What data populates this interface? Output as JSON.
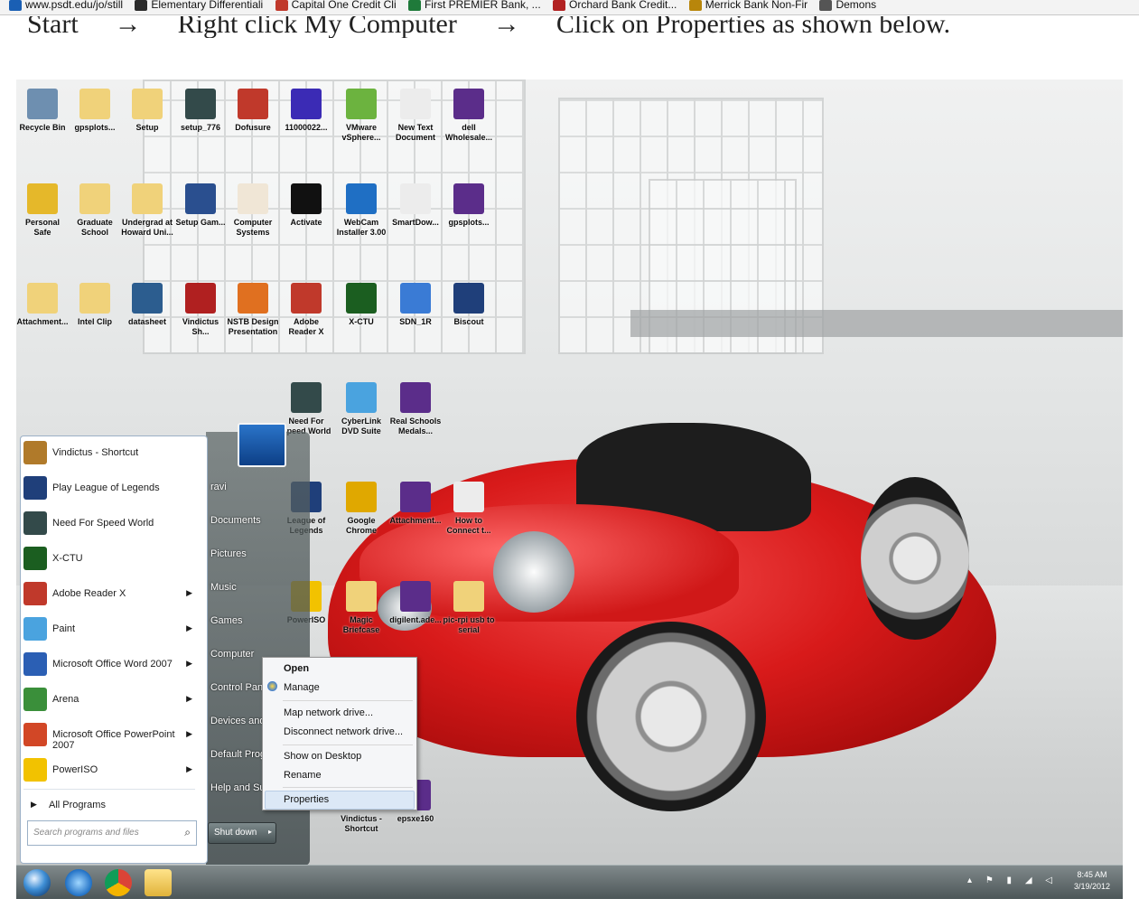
{
  "bookmarks": [
    {
      "label": "www.psdt.edu/jo/still",
      "color": "#1a5fb4"
    },
    {
      "label": "Elementary Differentiali",
      "color": "#2a2a2a"
    },
    {
      "label": "Capital One Credit Cli",
      "color": "#c0392b"
    },
    {
      "label": "First PREMIER Bank, ...",
      "color": "#1f7a3a"
    },
    {
      "label": "Orchard Bank Credit...",
      "color": "#b22222"
    },
    {
      "label": "Merrick Bank Non-Fir",
      "color": "#b8860b"
    },
    {
      "label": "Demons",
      "color": "#555555"
    }
  ],
  "caption": {
    "start": "Start",
    "step2": "Right click My Computer",
    "step3": "Click on Properties as shown below.",
    "arrow": "→"
  },
  "desktop_icons": [
    {
      "label": "Recycle Bin",
      "color": "#6e8fb0"
    },
    {
      "label": "gpsplots...",
      "color": "#f0d27a"
    },
    {
      "label": "Setup",
      "color": "#f0d27a"
    },
    {
      "label": "setup_776",
      "color": "#334a4a"
    },
    {
      "label": "Dofusure",
      "color": "#c0392b"
    },
    {
      "label": "11000022...",
      "color": "#3b2bb5"
    },
    {
      "label": "VMware vSphere...",
      "color": "#6cb33f"
    },
    {
      "label": "New Text Document",
      "color": "#ececec"
    },
    {
      "label": "dell Wholesale...",
      "color": "#5b2d8a"
    },
    {
      "label": "Personal Safe",
      "color": "#e5b82a"
    },
    {
      "label": "Graduate School",
      "color": "#f0d27a"
    },
    {
      "label": "Undergrad at Howard Uni...",
      "color": "#f0d27a"
    },
    {
      "label": "Setup Gam...",
      "color": "#2a4f8f"
    },
    {
      "label": "Computer Systems",
      "color": "#f0e6d6"
    },
    {
      "label": "Activate",
      "color": "#111111"
    },
    {
      "label": "WebCam Installer 3.00",
      "color": "#1f6fc4"
    },
    {
      "label": "SmartDow...",
      "color": "#ececec"
    },
    {
      "label": "gpsplots...",
      "color": "#5b2d8a"
    },
    {
      "label": "Attachment...",
      "color": "#f0d27a"
    },
    {
      "label": "Intel Clip",
      "color": "#f0d27a"
    },
    {
      "label": "datasheet",
      "color": "#2c5d8f"
    },
    {
      "label": "Vindictus Sh...",
      "color": "#b02020"
    },
    {
      "label": "NSTB Design Presentation",
      "color": "#e07020"
    },
    {
      "label": "Adobe Reader X",
      "color": "#c0392b"
    },
    {
      "label": "X-CTU",
      "color": "#1b5e20"
    },
    {
      "label": "SDN_1R",
      "color": "#3a7bd5"
    },
    {
      "label": "Biscout",
      "color": "#1f3f7a"
    },
    {
      "label": "Need For Speed World",
      "color": "#334a4a"
    },
    {
      "label": "CyberLink DVD Suite",
      "color": "#4aa3df"
    },
    {
      "label": "Real Schools Medals...",
      "color": "#5b2d8a"
    },
    {
      "label": "League of Legends",
      "color": "#1f3f7a"
    },
    {
      "label": "Google Chrome",
      "color": "#e0a800"
    },
    {
      "label": "Attachment...",
      "color": "#5b2d8a"
    },
    {
      "label": "How to Connect t...",
      "color": "#ececec"
    },
    {
      "label": "PowerISO",
      "color": "#f2c200"
    },
    {
      "label": "Magic Briefcase",
      "color": "#f0d27a"
    },
    {
      "label": "digilent.ade...",
      "color": "#5b2d8a"
    },
    {
      "label": "pic-rpi usb to serial",
      "color": "#f0d27a"
    },
    {
      "label": "Vindictus - Shortcut",
      "color": "#888888"
    },
    {
      "label": "epsxe160",
      "color": "#5b2d8a"
    }
  ],
  "start_menu": {
    "pinned": [
      {
        "label": "Vindictus - Shortcut",
        "color": "#b07a2a",
        "arrow": ""
      },
      {
        "label": "Play League of Legends",
        "color": "#1f3f7a",
        "arrow": ""
      },
      {
        "label": "Need For Speed World",
        "color": "#334a4a",
        "arrow": ""
      },
      {
        "label": "X-CTU",
        "color": "#1b5e20",
        "arrow": ""
      },
      {
        "label": "Adobe Reader X",
        "color": "#c0392b",
        "arrow": "▶"
      },
      {
        "label": "Paint",
        "color": "#4aa3df",
        "arrow": "▶"
      },
      {
        "label": "Microsoft Office Word 2007",
        "color": "#2b5fb4",
        "arrow": "▶"
      },
      {
        "label": "Arena",
        "color": "#3a8f3a",
        "arrow": "▶"
      },
      {
        "label": "Microsoft Office PowerPoint 2007",
        "color": "#d24726",
        "arrow": "▶"
      },
      {
        "label": "PowerISO",
        "color": "#f2c200",
        "arrow": "▶"
      }
    ],
    "all_programs": "All Programs",
    "all_programs_arrow": "▶",
    "search_placeholder": "Search programs and files",
    "search_icon": "⌕",
    "right_items": [
      "ravi",
      "Documents",
      "Pictures",
      "Music",
      "Games",
      "Computer",
      "Control Panel",
      "Devices and Printers",
      "Default Programs",
      "Help and Support"
    ],
    "shutdown_label": "Shut down",
    "shutdown_arrow": "▸"
  },
  "context_menu": {
    "items": [
      "Open",
      "Manage",
      "Map network drive...",
      "Disconnect network drive...",
      "Show on Desktop",
      "Rename",
      "Properties"
    ],
    "selected": "Properties"
  },
  "taskbar": {
    "time": "8:45 AM",
    "date": "3/19/2012",
    "tray_icons": "▴ ⚑ ▮ ◢ ◁"
  }
}
